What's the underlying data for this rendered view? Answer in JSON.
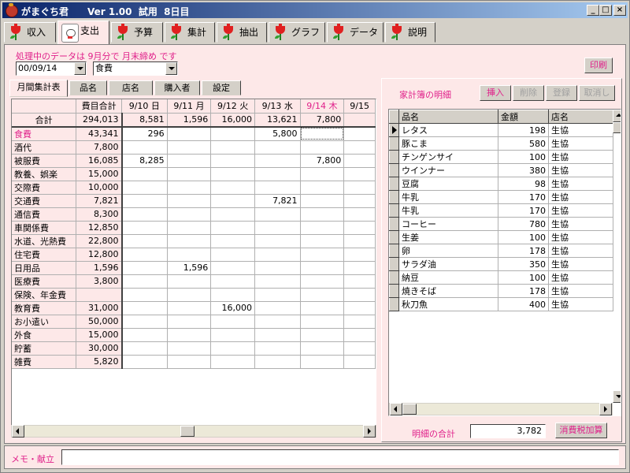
{
  "window": {
    "title": "がまぐち君　　Ver 1.00  試用  8日目",
    "controls": [
      "_",
      "□",
      "×"
    ]
  },
  "main_tabs": [
    {
      "label": "収入",
      "icon": "tulip-icon"
    },
    {
      "label": "支出",
      "icon": "maneki-neko-icon",
      "active": true
    },
    {
      "label": "予算",
      "icon": "tulip-icon"
    },
    {
      "label": "集計",
      "icon": "tulip-icon"
    },
    {
      "label": "抽出",
      "icon": "tulip-icon"
    },
    {
      "label": "グラフ",
      "icon": "tulip-icon"
    },
    {
      "label": "データ",
      "icon": "tulip-icon"
    },
    {
      "label": "説明",
      "icon": "tulip-icon"
    }
  ],
  "status_text": "処理中のデータは 9月分で 月末締め です",
  "date_combo": {
    "value": "00/09/14"
  },
  "category_combo": {
    "value": "食費"
  },
  "print_button": "印刷",
  "sub_tabs": [
    {
      "label": "月間集計表",
      "active": true
    },
    {
      "label": "品名"
    },
    {
      "label": "店名"
    },
    {
      "label": "購入者"
    },
    {
      "label": "設定"
    }
  ],
  "monthly_grid": {
    "header": {
      "blank": "",
      "total_col": "費目合計",
      "days": [
        "9/10 日",
        "9/11 月",
        "9/12 火",
        "9/13 水",
        "9/14 木",
        "9/15"
      ]
    },
    "sum_row": {
      "label": "合計",
      "total": "294,013",
      "days": [
        "8,581",
        "1,596",
        "16,000",
        "13,621",
        "7,800",
        ""
      ]
    },
    "rows": [
      {
        "label": "食費",
        "total": "43,341",
        "days": [
          "296",
          "",
          "",
          "5,800",
          "",
          ""
        ],
        "highlight": true
      },
      {
        "label": "酒代",
        "total": "7,800",
        "days": [
          "",
          "",
          "",
          "",
          "",
          ""
        ]
      },
      {
        "label": "被服費",
        "total": "16,085",
        "days": [
          "8,285",
          "",
          "",
          "",
          "7,800",
          ""
        ]
      },
      {
        "label": "教養、娯楽",
        "total": "15,000",
        "days": [
          "",
          "",
          "",
          "",
          "",
          ""
        ]
      },
      {
        "label": "交際費",
        "total": "10,000",
        "days": [
          "",
          "",
          "",
          "",
          "",
          ""
        ]
      },
      {
        "label": "交通費",
        "total": "7,821",
        "days": [
          "",
          "",
          "",
          "7,821",
          "",
          ""
        ]
      },
      {
        "label": "通信費",
        "total": "8,300",
        "days": [
          "",
          "",
          "",
          "",
          "",
          ""
        ]
      },
      {
        "label": "車関係費",
        "total": "12,850",
        "days": [
          "",
          "",
          "",
          "",
          "",
          ""
        ]
      },
      {
        "label": "水道、光熱費",
        "total": "22,800",
        "days": [
          "",
          "",
          "",
          "",
          "",
          ""
        ]
      },
      {
        "label": "住宅費",
        "total": "12,800",
        "days": [
          "",
          "",
          "",
          "",
          "",
          ""
        ]
      },
      {
        "label": "日用品",
        "total": "1,596",
        "days": [
          "",
          "1,596",
          "",
          "",
          "",
          ""
        ]
      },
      {
        "label": "医療費",
        "total": "3,800",
        "days": [
          "",
          "",
          "",
          "",
          "",
          ""
        ]
      },
      {
        "label": "保険、年金費",
        "total": "",
        "days": [
          "",
          "",
          "",
          "",
          "",
          ""
        ]
      },
      {
        "label": "教育費",
        "total": "31,000",
        "days": [
          "",
          "",
          "16,000",
          "",
          "",
          ""
        ]
      },
      {
        "label": "お小遣い",
        "total": "50,000",
        "days": [
          "",
          "",
          "",
          "",
          "",
          ""
        ]
      },
      {
        "label": "外食",
        "total": "15,000",
        "days": [
          "",
          "",
          "",
          "",
          "",
          ""
        ]
      },
      {
        "label": "貯蓄",
        "total": "30,000",
        "days": [
          "",
          "",
          "",
          "",
          "",
          ""
        ]
      },
      {
        "label": "雑費",
        "total": "5,820",
        "days": [
          "",
          "",
          "",
          "",
          "",
          ""
        ]
      }
    ]
  },
  "detail_panel": {
    "title": "家計簿の明細",
    "buttons": {
      "insert": "挿入",
      "delete": "削除",
      "register": "登録",
      "cancel": "取消し"
    },
    "columns": [
      "品名",
      "金額",
      "店名"
    ],
    "rows": [
      {
        "name": "レタス",
        "amount": "198",
        "shop": "生協"
      },
      {
        "name": "豚こま",
        "amount": "580",
        "shop": "生協"
      },
      {
        "name": "チンゲンサイ",
        "amount": "100",
        "shop": "生協"
      },
      {
        "name": "ウインナー",
        "amount": "380",
        "shop": "生協"
      },
      {
        "name": "豆腐",
        "amount": "98",
        "shop": "生協"
      },
      {
        "name": "牛乳",
        "amount": "170",
        "shop": "生協"
      },
      {
        "name": "牛乳",
        "amount": "170",
        "shop": "生協"
      },
      {
        "name": "コーヒー",
        "amount": "780",
        "shop": "生協"
      },
      {
        "name": "生姜",
        "amount": "100",
        "shop": "生協"
      },
      {
        "name": "卵",
        "amount": "178",
        "shop": "生協"
      },
      {
        "name": "サラダ油",
        "amount": "350",
        "shop": "生協"
      },
      {
        "name": "納豆",
        "amount": "100",
        "shop": "生協"
      },
      {
        "name": "焼きそば",
        "amount": "178",
        "shop": "生協"
      },
      {
        "name": "秋刀魚",
        "amount": "400",
        "shop": "生協"
      }
    ],
    "total_label": "明細の合計",
    "total_value": "3,782",
    "tax_button": "消費税加算"
  },
  "memo": {
    "label": "メモ・献立",
    "value": ""
  },
  "colors": {
    "accent_pink": "#e0208a",
    "panel_bg": "#fde8e8",
    "title_bar": "#0a246a"
  }
}
